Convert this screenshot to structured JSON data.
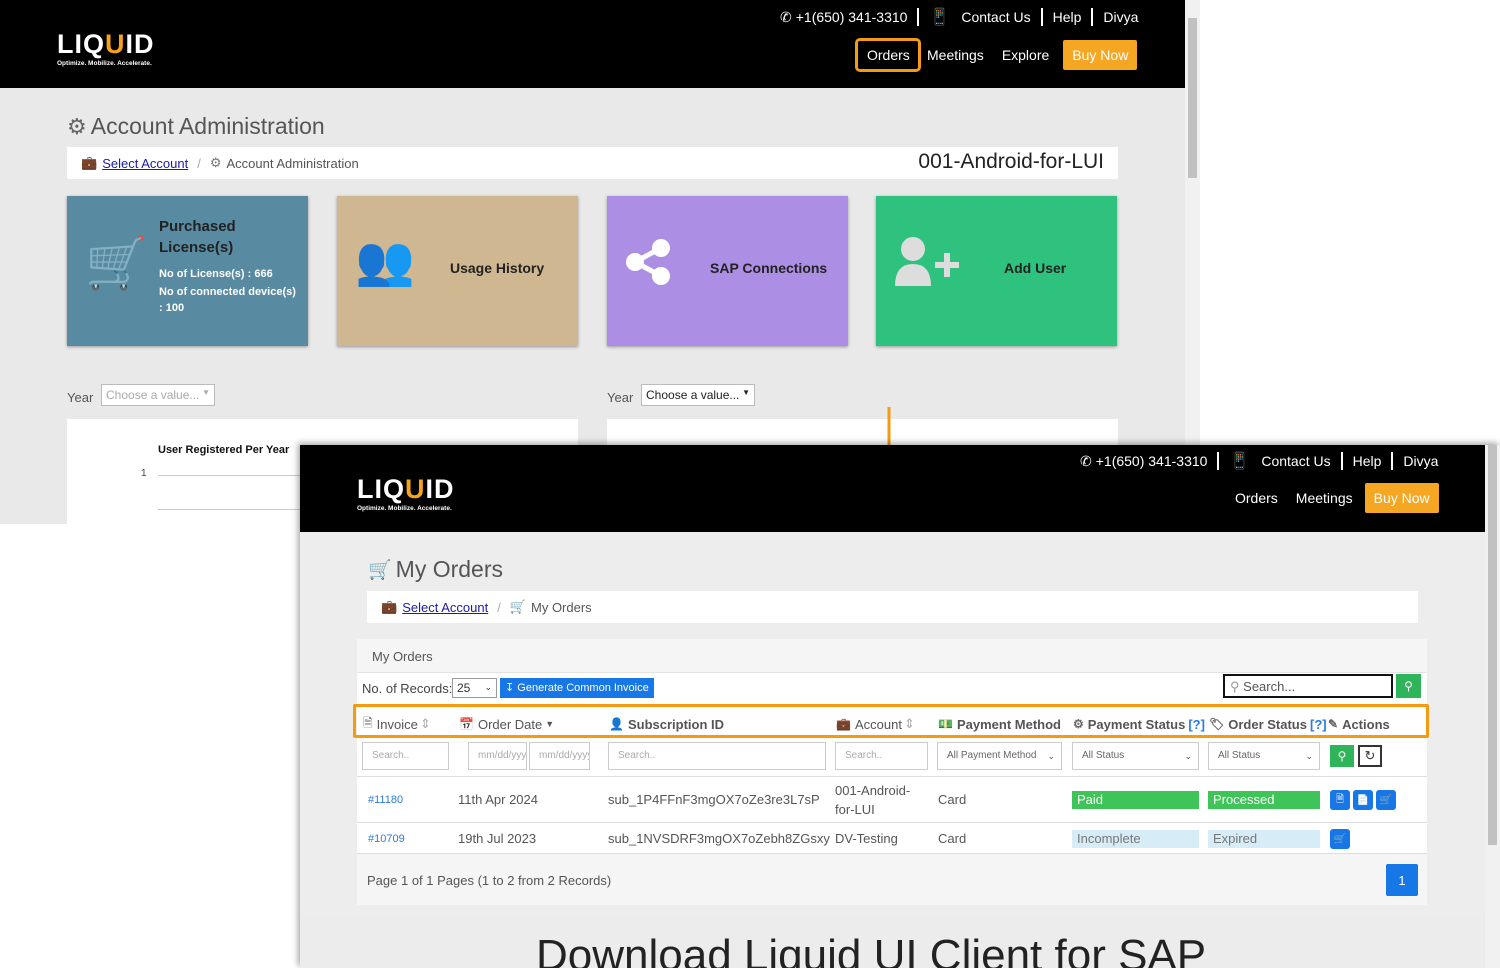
{
  "brand": {
    "name_left": "LIQ",
    "name_u": "U",
    "name_right": "ID",
    "tagline": "Optimize. Mobilize. Accelerate.",
    "accent": "#f5a623",
    "highlight": "#f59b12"
  },
  "back": {
    "top": {
      "phone": "+1(650) 341-3310",
      "contact": "Contact Us",
      "help": "Help",
      "user": "Divya"
    },
    "nav": {
      "orders": "Orders",
      "meetings": "Meetings",
      "explore": "Explore",
      "buy": "Buy Now"
    },
    "title": "Account Administration",
    "breadcrumb": {
      "link": "Select Account",
      "current": "Account Administration",
      "account": "001-Android-for-LUI"
    },
    "cards": {
      "licenses": {
        "title": "Purchased License(s)",
        "line1": "No of License(s) : 666",
        "line2": "No of connected device(s) : 100",
        "color": "#588aa2"
      },
      "usage": {
        "title": "Usage History",
        "color": "#cfb791"
      },
      "sap": {
        "title": "SAP Connections",
        "color": "#ac8fe4"
      },
      "adduser": {
        "title": "Add User",
        "color": "#2ec27e"
      }
    },
    "year_label_left": "Year",
    "year_select_left": "Choose a value...",
    "year_label_right": "Year",
    "year_select_right": "Choose a value...",
    "chart_title": "User Registered Per Year",
    "chart_tick": "1"
  },
  "front": {
    "top": {
      "phone": "+1(650) 341-3310",
      "contact": "Contact Us",
      "help": "Help",
      "user": "Divya"
    },
    "nav": {
      "orders": "Orders",
      "meetings": "Meetings",
      "buy": "Buy Now"
    },
    "title": "My Orders",
    "breadcrumb": {
      "link": "Select Account",
      "current": "My Orders"
    },
    "panel_title": "My Orders",
    "records_label": "No. of Records:",
    "records_value": "25",
    "generate_button": "Generate Common Invoice",
    "search_placeholder": "Search...",
    "columns": {
      "invoice": "Invoice",
      "order_date": "Order Date",
      "subscription": "Subscription ID",
      "account": "Account",
      "payment_method": "Payment Method",
      "payment_status": "Payment Status",
      "order_status": "Order Status",
      "help_mark": "[?]",
      "actions": "Actions"
    },
    "filters": {
      "search": "Search..",
      "date": "mm/dd/yyyy",
      "payment_method": "All Payment Method",
      "status": "All Status"
    },
    "rows": [
      {
        "invoice": "#11180",
        "date": "11th Apr 2024",
        "subscription": "sub_1P4FFnF3mgOX7oZe3re3L7sP",
        "account_1": "001-Android-",
        "account_2": "for-LUI",
        "method": "Card",
        "payment_status": "Paid",
        "order_status": "Processed"
      },
      {
        "invoice": "#10709",
        "date": "19th Jul 2023",
        "subscription": "sub_1NVSDRF3mgOX7oZebh8ZGsxy",
        "account_1": "DV-Testing",
        "account_2": "",
        "method": "Card",
        "payment_status": "Incomplete",
        "order_status": "Expired"
      }
    ],
    "pagination_text": "Page 1 of 1 Pages (1 to 2 from 2 Records)",
    "page_number": "1",
    "download_heading": "Download Liquid UI Client for SAP"
  }
}
